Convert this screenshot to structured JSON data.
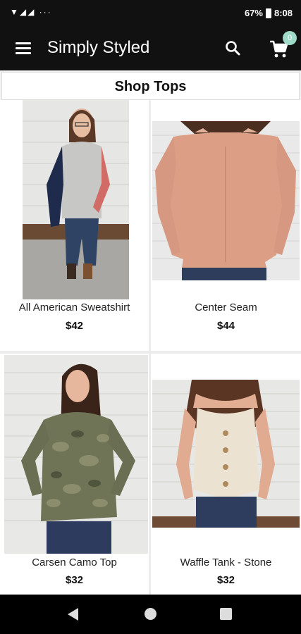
{
  "status_bar": {
    "left_icons": "▼◢◢ ···",
    "battery": "67%",
    "time": "8:08"
  },
  "app_bar": {
    "title": "Simply Styled",
    "cart_count": "0"
  },
  "section": {
    "title": "Shop Tops"
  },
  "products": [
    {
      "name": "All American Sweatshirt",
      "price": "$42"
    },
    {
      "name": "Center Seam",
      "price": "$44"
    },
    {
      "name": "Carsen Camo Top",
      "price": "$32"
    },
    {
      "name": "Waffle Tank - Stone",
      "price": "$32"
    }
  ],
  "colors": {
    "bar": "#111111",
    "badge": "#9fd9c7"
  },
  "icons": [
    "menu-icon",
    "search-icon",
    "cart-icon",
    "back-icon",
    "home-icon",
    "recents-icon"
  ]
}
